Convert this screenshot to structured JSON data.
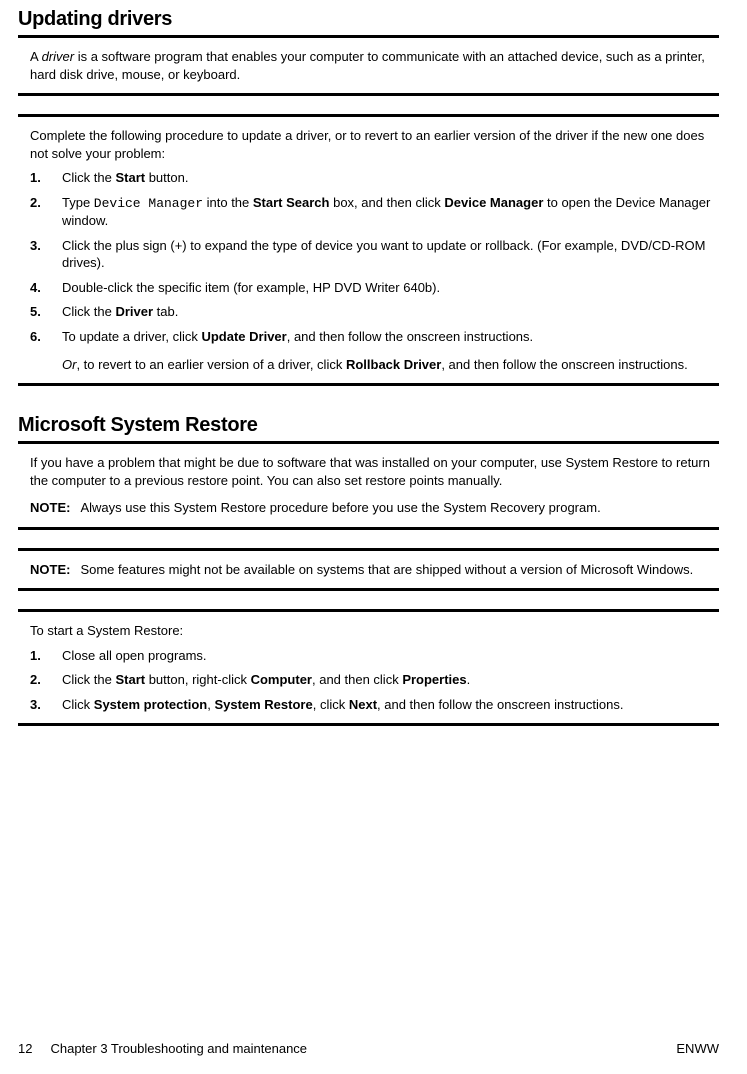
{
  "section1": {
    "title": "Updating drivers",
    "intro_pre": "A ",
    "intro_italic": "driver",
    "intro_post": " is a software program that enables your computer to communicate with an attached device, such as a printer, hard disk drive, mouse, or keyboard.",
    "lead": "Complete the following procedure to update a driver, or to revert to an earlier version of the driver if the new one does not solve your problem:",
    "steps": {
      "s1": {
        "num": "1.",
        "pre": "Click the ",
        "b1": "Start",
        "post": " button."
      },
      "s2": {
        "num": "2.",
        "pre": "Type ",
        "mono": "Device Manager",
        "mid": " into the ",
        "b1": "Start Search",
        "mid2": " box, and then click ",
        "b2": "Device Manager",
        "post": " to open the Device Manager window."
      },
      "s3": {
        "num": "3.",
        "text": "Click the plus sign (+) to expand the type of device you want to update or rollback. (For example, DVD/CD-ROM drives)."
      },
      "s4": {
        "num": "4.",
        "text": "Double-click the specific item (for example, HP DVD Writer 640b)."
      },
      "s5": {
        "num": "5.",
        "pre": "Click the ",
        "b1": "Driver",
        "post": " tab."
      },
      "s6": {
        "num": "6.",
        "pre": "To update a driver, click ",
        "b1": "Update Driver",
        "post": ", and then follow the onscreen instructions.",
        "or_i": "Or",
        "or_mid": ", to revert to an earlier version of a driver, click ",
        "or_b": "Rollback Driver",
        "or_post": ", and then follow the onscreen instructions."
      }
    }
  },
  "section2": {
    "title": "Microsoft System Restore",
    "intro": "If you have a problem that might be due to software that was installed on your computer, use System Restore to return the computer to a previous restore point. You can also set restore points manually.",
    "note1_label": "NOTE:",
    "note1_text": "Always use this System Restore procedure before you use the System Recovery program.",
    "note2_label": "NOTE:",
    "note2_text": "Some features might not be available on systems that are shipped without a version of Microsoft Windows.",
    "lead": "To start a System Restore:",
    "steps": {
      "s1": {
        "num": "1.",
        "text": "Close all open programs."
      },
      "s2": {
        "num": "2.",
        "pre": "Click the ",
        "b1": "Start",
        "mid1": " button, right-click ",
        "b2": "Computer",
        "mid2": ", and then click ",
        "b3": "Properties",
        "post": "."
      },
      "s3": {
        "num": "3.",
        "pre": "Click ",
        "b1": "System protection",
        "sep1": ", ",
        "b2": "System Restore",
        "sep2": ", click ",
        "b3": "Next",
        "post": ", and then follow the onscreen instructions."
      }
    }
  },
  "footer": {
    "page": "12",
    "chapter": "Chapter 3   Troubleshooting and maintenance",
    "right": "ENWW"
  }
}
